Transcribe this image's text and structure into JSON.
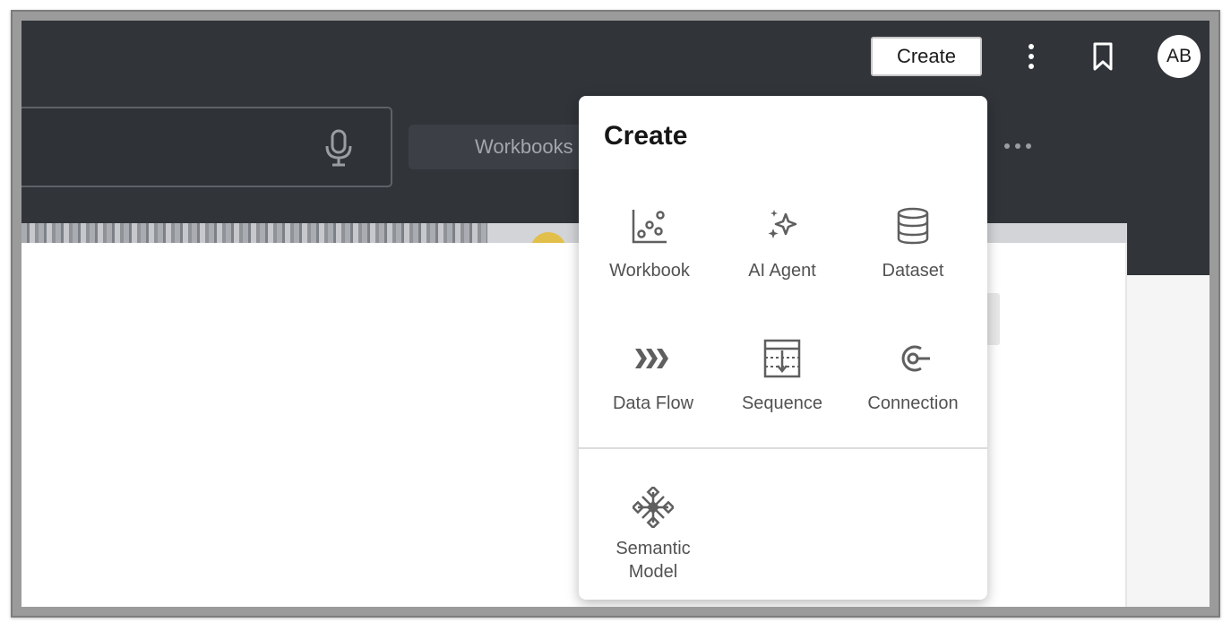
{
  "header": {
    "create_label": "Create",
    "avatar_initials": "AB"
  },
  "toolbar": {
    "workbooks_pill": "Workbooks"
  },
  "create_menu": {
    "title": "Create",
    "items": [
      {
        "label": "Workbook",
        "icon": "workbook-icon"
      },
      {
        "label": "AI Agent",
        "icon": "sparkle-icon"
      },
      {
        "label": "Dataset",
        "icon": "database-icon"
      },
      {
        "label": "Data Flow",
        "icon": "data-flow-icon"
      },
      {
        "label": "Sequence",
        "icon": "sequence-icon"
      },
      {
        "label": "Connection",
        "icon": "connection-icon"
      },
      {
        "label": "Semantic Model",
        "icon": "semantic-model-icon"
      }
    ]
  },
  "icons": {
    "kebab": "kebab-vertical-icon",
    "bookmark": "bookmark-icon",
    "mic": "microphone-icon",
    "more": "more-horizontal-icon"
  },
  "colors": {
    "topbar": "#313439",
    "menu_background": "#ffffff",
    "icon_gray": "#5f5f5f"
  }
}
